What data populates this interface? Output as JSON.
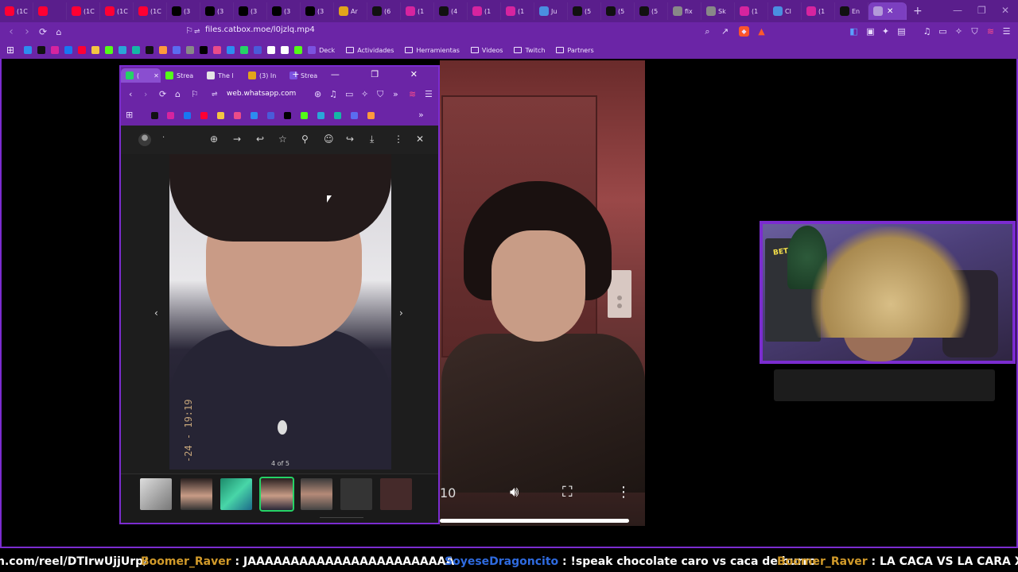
{
  "browser": {
    "tabs": [
      {
        "label": "(1C",
        "icon": "youtube-icon",
        "color": "#ff0033"
      },
      {
        "label": "",
        "icon": "youtube-icon",
        "color": "#ff0033"
      },
      {
        "label": "(1C",
        "icon": "youtube-icon",
        "color": "#ff0033"
      },
      {
        "label": "(1C",
        "icon": "youtube-icon",
        "color": "#ff0033"
      },
      {
        "label": "(1C",
        "icon": "youtube-icon",
        "color": "#ff0033"
      },
      {
        "label": "(3",
        "icon": "x-icon",
        "color": "#000000"
      },
      {
        "label": "(3",
        "icon": "x-icon",
        "color": "#000000"
      },
      {
        "label": "(3",
        "icon": "x-icon",
        "color": "#000000"
      },
      {
        "label": "(3",
        "icon": "x-icon",
        "color": "#000000"
      },
      {
        "label": "(3",
        "icon": "x-icon",
        "color": "#000000"
      },
      {
        "label": "Ar",
        "icon": "bookmark-icon",
        "color": "#e2a41b"
      },
      {
        "label": "(6",
        "icon": "tiktok-icon",
        "color": "#111111"
      },
      {
        "label": "(1",
        "icon": "instagram-icon",
        "color": "#d6249f"
      },
      {
        "label": "(4",
        "icon": "tiktok-icon",
        "color": "#111111"
      },
      {
        "label": "(1",
        "icon": "instagram-icon",
        "color": "#d6249f"
      },
      {
        "label": "(1",
        "icon": "instagram-icon",
        "color": "#d6249f"
      },
      {
        "label": "Ju",
        "icon": "globe-icon",
        "color": "#4a8fe0"
      },
      {
        "label": "(5",
        "icon": "tiktok-icon",
        "color": "#111111"
      },
      {
        "label": "(5",
        "icon": "tiktok-icon",
        "color": "#111111"
      },
      {
        "label": "(5",
        "icon": "tiktok-icon",
        "color": "#111111"
      },
      {
        "label": "fix",
        "icon": "globe-icon",
        "color": "#888888"
      },
      {
        "label": "Sk",
        "icon": "globe-icon",
        "color": "#888888"
      },
      {
        "label": "(1",
        "icon": "instagram-icon",
        "color": "#d6249f"
      },
      {
        "label": "Cl",
        "icon": "chrome-icon",
        "color": "#4a8fe0"
      },
      {
        "label": "(1",
        "icon": "instagram-icon",
        "color": "#d6249f"
      },
      {
        "label": "En",
        "icon": "tiktok-icon",
        "color": "#111111"
      }
    ],
    "url": "files.catbox.moe/l0jzlq.mp4",
    "bookmarks": [
      {
        "label": "Deck"
      },
      {
        "label": "Actividades"
      },
      {
        "label": "Herramientas"
      },
      {
        "label": "Videos"
      },
      {
        "label": "Twitch"
      },
      {
        "label": "Partners"
      }
    ]
  },
  "popup": {
    "tabs": [
      {
        "label": "(",
        "color": "#25d366"
      },
      {
        "label": "Strea",
        "color": "#53fc18"
      },
      {
        "label": "The l",
        "color": "#e5e5e5"
      },
      {
        "label": "(3) In",
        "color": "#e2a41b"
      },
      {
        "label": "Strea",
        "color": "#7b52e0"
      }
    ],
    "url": "web.whatsapp.com",
    "viewer_name": "·",
    "counter": "4 of 5",
    "photo_date": "-24 - 19:19",
    "selected_thumb": 3
  },
  "video": {
    "time": "10"
  },
  "webcam": {
    "sign_text": "BETOGRILL"
  },
  "chat": {
    "messages": [
      {
        "user": "",
        "text": "n.com/reel/DTIrwUjjUrp/"
      },
      {
        "user": "Boomer_Raver",
        "text": " : JAAAAAAAAAAAAAAAAAAAAAAAA"
      },
      {
        "user": "SoyeseDragoncito",
        "text": " : !speak chocolate caro vs caca de burro"
      },
      {
        "user": "Boomer_Raver",
        "text": " : LA CACA VS LA CARA XD"
      }
    ]
  },
  "colors": {
    "accent": "#7b2cd0",
    "whatsapp": "#25d366"
  }
}
